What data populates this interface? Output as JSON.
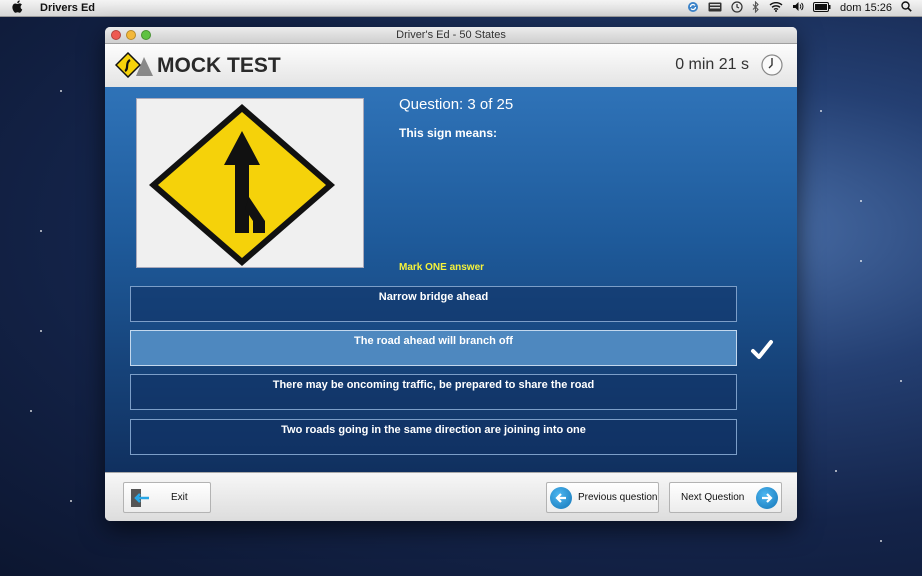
{
  "menubar": {
    "app_name": "Drivers Ed",
    "clock": "dom 15:26",
    "icons": [
      "apple-icon",
      "sync-icon",
      "keyboard-icon",
      "timemachine-icon",
      "bluetooth-icon",
      "wifi-icon",
      "volume-icon",
      "battery-icon",
      "spotlight-icon"
    ]
  },
  "window": {
    "title": "Driver's Ed - 50 States",
    "header_title": "MOCK TEST",
    "timer": "0 min 21 s"
  },
  "question": {
    "number_label": "Question: 3 of 25",
    "text": "This sign means:",
    "instruction": "Mark ONE answer",
    "sign_icon": "merging-traffic-sign-icon"
  },
  "answers": [
    {
      "label": "Narrow bridge ahead",
      "selected": false
    },
    {
      "label": "The road ahead will branch off",
      "selected": true
    },
    {
      "label": "There may be oncoming traffic, be prepared to share the road",
      "selected": false
    },
    {
      "label": "Two roads going in the same direction are joining into one",
      "selected": false
    }
  ],
  "footer": {
    "exit_label": "Exit",
    "prev_label": "Previous question",
    "next_label": "Next Question"
  },
  "colors": {
    "accent_blue": "#1e5a9a",
    "instruction_yellow": "#f6f33a",
    "sign_yellow": "#f5d20a"
  }
}
